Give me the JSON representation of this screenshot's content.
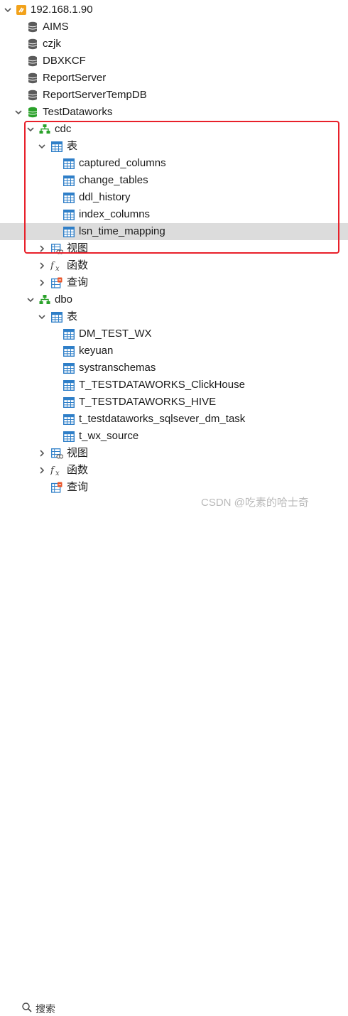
{
  "tree": {
    "server": "192.168.1.90",
    "databases": [
      "AIMS",
      "czjk",
      "DBXKCF",
      "ReportServer",
      "ReportServerTempDB"
    ],
    "active_db": "TestDataworks",
    "schema_cdc": {
      "name": "cdc",
      "tables_label": "表",
      "tables": [
        "captured_columns",
        "change_tables",
        "ddl_history",
        "index_columns",
        "lsn_time_mapping"
      ],
      "views_label": "视图",
      "functions_label": "函数",
      "queries_label": "查询"
    },
    "schema_dbo": {
      "name": "dbo",
      "tables_label": "表",
      "tables": [
        "DM_TEST_WX",
        "keyuan",
        "systranschemas",
        "T_TESTDATAWORKS_ClickHouse",
        "T_TESTDATAWORKS_HIVE",
        "t_testdataworks_sqlsever_dm_task",
        "t_wx_source"
      ],
      "views_label": "视图",
      "functions_label": "函数",
      "queries_label": "查询"
    }
  },
  "selected_item": "lsn_time_mapping",
  "search": {
    "label": "搜索"
  },
  "watermark": "CSDN @吃素的哈士奇",
  "colors": {
    "highlight_box": "#e8202a",
    "selected_row": "#dcdcdc",
    "db_icon": "#5b5b5b",
    "active_db_icon": "#2aa12a",
    "table_icon": "#2f7fc8"
  }
}
